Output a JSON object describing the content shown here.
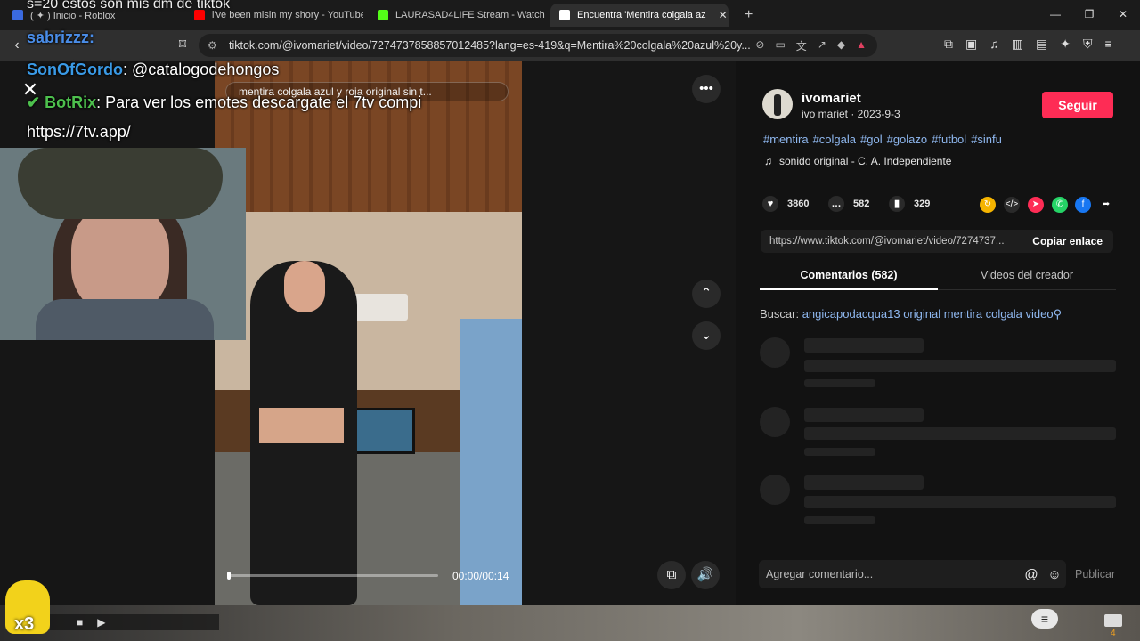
{
  "browser": {
    "tabs": [
      {
        "label": "( ✦ ) Inicio - Roblox",
        "favicon_color": "#3a6ae0"
      },
      {
        "label": "i've been misin my shory - YouTube",
        "favicon_color": "#ff0000"
      },
      {
        "label": "LAURASAD4LIFE Stream - Watch Live",
        "favicon_color": "#53fc18"
      },
      {
        "label": "Encuentra 'Mentira colgala az",
        "favicon_color": "#ffffff"
      }
    ],
    "new_tab": "+",
    "url": "tiktok.com/@ivomariet/video/7274737858857012485?lang=es-419&q=Mentira%20colgala%20azul%20y..."
  },
  "overlay": {
    "top_chat": "s=20 estos son mis dm de tiktok",
    "chat1_name": "sabrizzz:",
    "chat2_name": "SonOfGordo",
    "chat2_msg": ": @catalogodehongos",
    "chat3_name": "BotRix",
    "chat3_msg": ": Para ver los emotes descargate el 7tv compi",
    "chat3_link": "https://7tv.app/",
    "mascot_count": "x3"
  },
  "video": {
    "title": "mentira colgala azul y roja original sin t...",
    "time": "00:00/00:14",
    "progress": 0.0
  },
  "panel": {
    "username": "ivomariet",
    "subline": "ivo mariet · 2023-9-3",
    "follow": "Seguir",
    "hashtags": [
      "#mentira",
      "#colgala",
      "#gol",
      "#golazo",
      "#futbol",
      "#sinfu"
    ],
    "sound": "sonido original - C. A. Independiente",
    "likes": "3860",
    "comments": "582",
    "saves": "329",
    "share_link": "https://www.tiktok.com/@ivomariet/video/7274737...",
    "copy_label": "Copiar enlace",
    "tab_comments": "Comentarios (582)",
    "tab_videos": "Videos del creador",
    "search_label": "Buscar:",
    "search_query": "angicapodacqua13 original mentira colgala video",
    "comment_placeholder": "Agregar comentario...",
    "publish": "Publicar"
  },
  "taskbar": {
    "mail_count": "4"
  },
  "colors": {
    "accent": "#fe2c55",
    "link": "#8fb8f0",
    "background": "#121212"
  }
}
